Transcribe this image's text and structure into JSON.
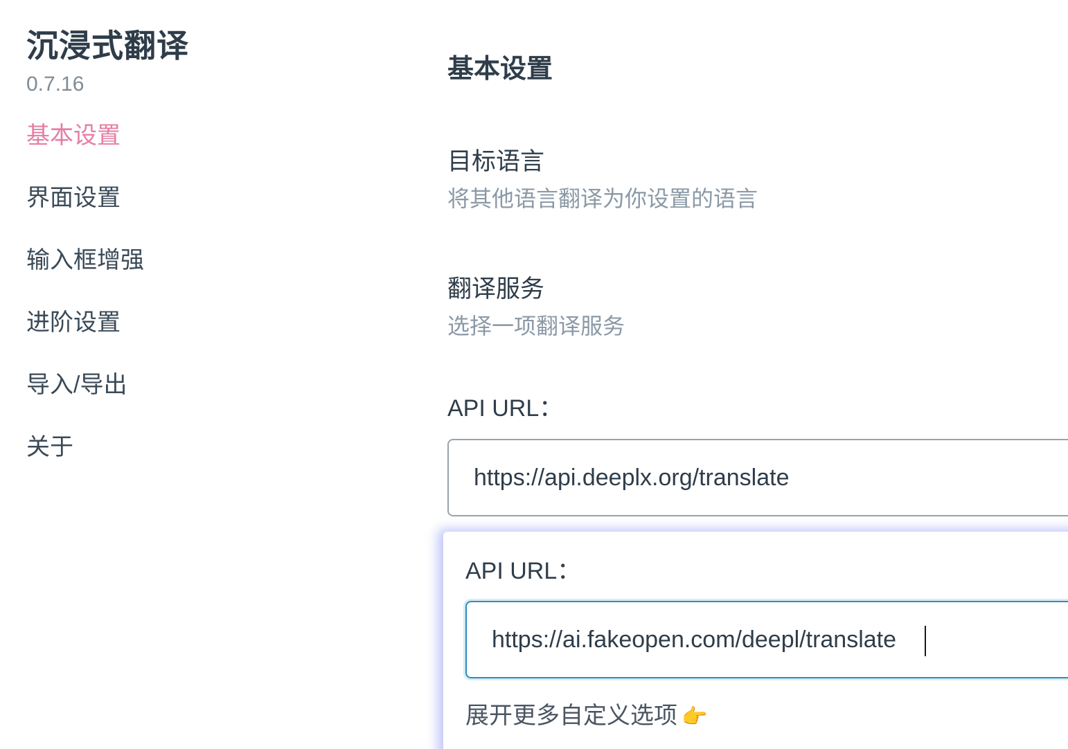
{
  "app": {
    "title": "沉浸式翻译",
    "version": "0.7.16"
  },
  "sidebar": {
    "items": [
      {
        "label": "基本设置",
        "active": true
      },
      {
        "label": "界面设置",
        "active": false
      },
      {
        "label": "输入框增强",
        "active": false
      },
      {
        "label": "进阶设置",
        "active": false
      },
      {
        "label": "导入/导出",
        "active": false
      },
      {
        "label": "关于",
        "active": false
      }
    ]
  },
  "main": {
    "section_title": "基本设置",
    "target_language": {
      "label": "目标语言",
      "description": "将其他语言翻译为你设置的语言"
    },
    "translation_service": {
      "label": "翻译服务",
      "description": "选择一项翻译服务"
    },
    "api_url": {
      "label": "API URL：",
      "value": "https://api.deeplx.org/translate"
    }
  },
  "popup": {
    "api_url": {
      "label": "API URL：",
      "value": "https://ai.fakeopen.com/deepl/translate"
    },
    "expand_link": "展开更多自定义选项",
    "expand_icon": "pointing-right-hand-icon",
    "expand_glyph": "👉"
  },
  "colors": {
    "accent": "#e57ea4",
    "focus_border": "#2a8fbd",
    "popup_glow": "#aab4f5",
    "description": "#8b99a6"
  }
}
